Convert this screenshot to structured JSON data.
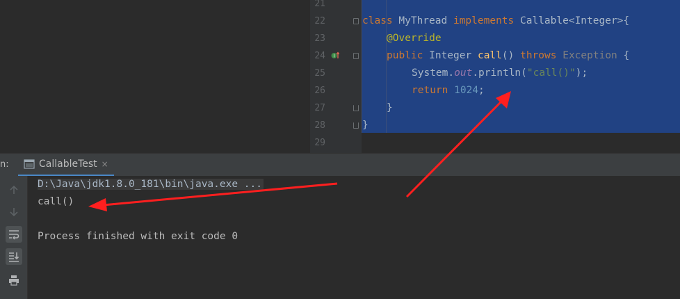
{
  "editor": {
    "lines": [
      {
        "no": "21"
      },
      {
        "no": "22",
        "tokens": {
          "kw_class": "class",
          "name": " MyThread ",
          "kw_impl": "implements",
          "rest": " Callable<Integer>{"
        }
      },
      {
        "no": "23",
        "tokens": {
          "annotation": "@Override"
        }
      },
      {
        "no": "24",
        "tokens": {
          "kw_public": "public",
          "type": " Integer ",
          "method": "call",
          "parens": "() ",
          "kw_throws": "throws",
          "space": " ",
          "exception": "Exception",
          "brace": " {"
        }
      },
      {
        "no": "25",
        "tokens": {
          "obj": "System.",
          "field": "out",
          "call": ".println(",
          "str": "\"call()\"",
          "end": ");"
        }
      },
      {
        "no": "26",
        "tokens": {
          "kw_return": "return",
          "space": " ",
          "num": "1024",
          "end": ";"
        }
      },
      {
        "no": "27",
        "tokens": {
          "brace": "}"
        }
      },
      {
        "no": "28",
        "tokens": {
          "brace": "}"
        }
      },
      {
        "no": "29"
      }
    ]
  },
  "run": {
    "prefix": "n:",
    "tab_label": "CallableTest",
    "close_glyph": "×"
  },
  "console": {
    "command": "D:\\Java\\jdk1.8.0_181\\bin\\java.exe ...",
    "output": "call()",
    "exit": "Process finished with exit code 0"
  },
  "icons": {
    "tab": "console-icon",
    "gutter": "implements-method-icon",
    "tools": [
      "arrow-up-icon",
      "arrow-down-icon",
      "soft-wrap-icon",
      "scroll-to-end-icon",
      "print-icon"
    ]
  },
  "colors": {
    "selection": "#214283",
    "keyword": "#cc7832",
    "annotation": "#bbb529",
    "method": "#ffc66d",
    "number": "#6897bb",
    "string": "#6a8759",
    "arrow": "#ff1f1f"
  }
}
